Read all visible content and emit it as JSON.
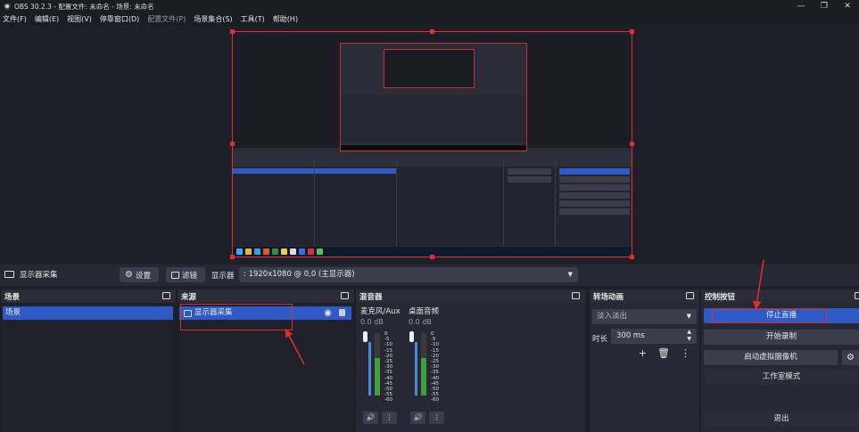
{
  "window": {
    "title": "OBS 30.2.3 - 配置文件: 未命名 - 场景: 未命名",
    "min": "—",
    "max": "❐",
    "close": "✕"
  },
  "menu": [
    "文件(F)",
    "编辑(E)",
    "视图(V)",
    "停靠窗口(D)",
    "配置文件(P)",
    "场景集合(S)",
    "工具(T)",
    "帮助(H)"
  ],
  "properties_bar": {
    "source_name": "显示器采集",
    "settings_label": "设置",
    "filters_label": "滤镜",
    "display_label": "显示器",
    "display_value": ": 1920x1080 @ 0,0 (主显示器)"
  },
  "scenes": {
    "title": "场景",
    "items": [
      "场景"
    ]
  },
  "sources": {
    "title": "来源",
    "items": [
      "显示器采集"
    ]
  },
  "mixer": {
    "title": "混音器",
    "channels": [
      {
        "name": "麦克风/Aux",
        "db": "0.0 dB",
        "level": 0.62
      },
      {
        "name": "桌面音频",
        "db": "0.0 dB",
        "level": 0.62
      }
    ],
    "ticks": [
      "0",
      "-5",
      "-10",
      "-15",
      "-20",
      "-25",
      "-30",
      "-35",
      "-40",
      "-45",
      "-50",
      "-55",
      "-60"
    ]
  },
  "transitions": {
    "title": "转场动画",
    "selected": "淡入淡出",
    "duration_label": "时长",
    "duration_value": "300 ms"
  },
  "controls": {
    "title": "控制按钮",
    "stop_stream": "停止直播",
    "start_record": "开始录制",
    "start_vcam": "启动虚拟摄像机",
    "studio_mode": "工作室模式",
    "exit": "退出"
  },
  "colors": {
    "accent": "#2f59c5",
    "annotation": "#d83030"
  }
}
